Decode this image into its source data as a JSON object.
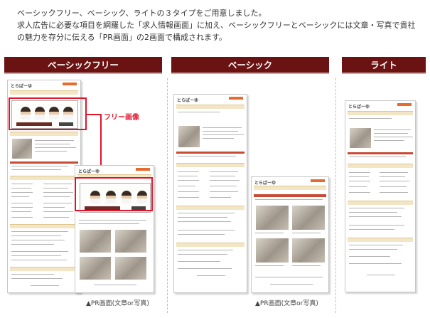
{
  "intro": {
    "line1": "ベーシックフリー、ベーシック、ライトの３タイプをご用意しました。",
    "line2": "求人広告に必要な項目を網羅した「求人情報画面」に加え、ベーシックフリーとベーシックには文章・写真で貴社",
    "line3": "の魅力を存分に伝える「PR画面」の2画面で構成されます。"
  },
  "columns": [
    {
      "label": "ベーシックフリー"
    },
    {
      "label": "ベーシック"
    },
    {
      "label": "ライト"
    }
  ],
  "annotation": {
    "free_image": "フリー画像"
  },
  "captions": {
    "basic_free": "▲PR画面(文章or写真)",
    "basic": "▲PR画面(文章or写真)"
  },
  "colors": {
    "header_bg": "#6b1312",
    "highlight": "#e3142a"
  }
}
